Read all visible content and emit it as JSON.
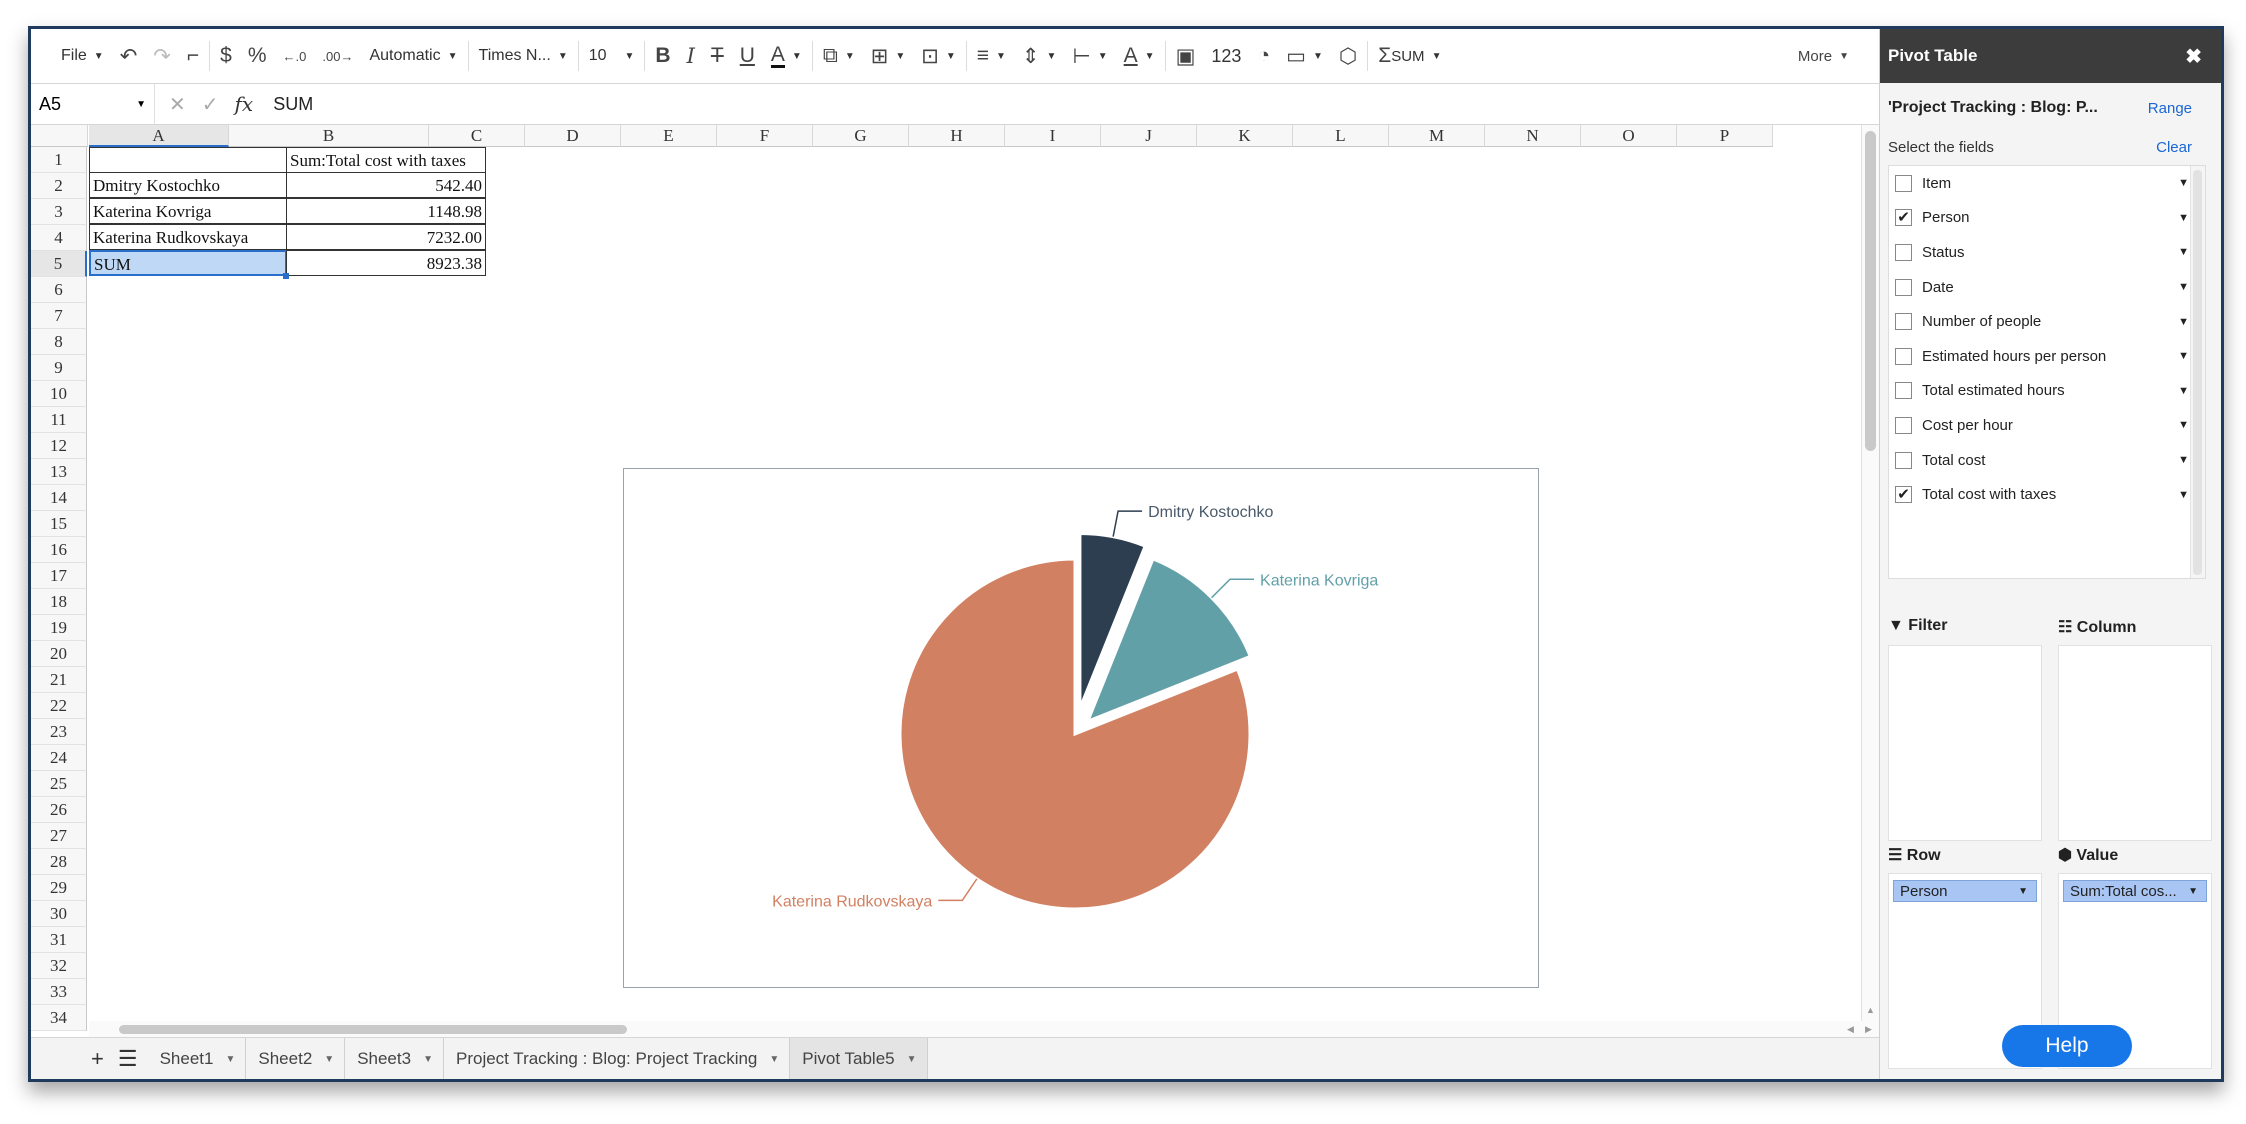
{
  "toolbar": {
    "file": "File",
    "number_format": "Automatic",
    "font_name": "Times N...",
    "font_size": "10",
    "number_label": "123",
    "sum_label": "SUM",
    "more": "More"
  },
  "formula_bar": {
    "cell_ref": "A5",
    "fx": "fx",
    "value": "SUM"
  },
  "columns": [
    "A",
    "B",
    "C",
    "D",
    "E",
    "F",
    "G",
    "H",
    "I",
    "J",
    "K",
    "L",
    "M",
    "N",
    "O",
    "P"
  ],
  "rows": [
    "1",
    "2",
    "3",
    "4",
    "5",
    "6",
    "7",
    "8",
    "9",
    "10",
    "11",
    "12",
    "13",
    "14",
    "15",
    "16",
    "17",
    "18",
    "19",
    "20",
    "21",
    "22",
    "23",
    "24",
    "25",
    "26",
    "27",
    "28",
    "29",
    "30",
    "31",
    "32",
    "33",
    "34"
  ],
  "table": {
    "header": "Sum:Total cost with taxes",
    "rows": [
      {
        "name": "Dmitry Kostochko",
        "value": "542.40"
      },
      {
        "name": "Katerina Kovriga",
        "value": "1148.98"
      },
      {
        "name": "Katerina Rudkovskaya",
        "value": "7232.00"
      },
      {
        "name": "SUM",
        "value": "8923.38"
      }
    ]
  },
  "chart_data": {
    "type": "pie",
    "categories": [
      "Dmitry Kostochko",
      "Katerina Kovriga",
      "Katerina Rudkovskaya"
    ],
    "values": [
      542.4,
      1148.98,
      7232.0
    ],
    "colors": [
      "#2d3e50",
      "#62a0a8",
      "#d28062"
    ]
  },
  "sheets": [
    {
      "label": "Sheet1"
    },
    {
      "label": "Sheet2"
    },
    {
      "label": "Sheet3"
    },
    {
      "label": "Project Tracking : Blog: Project Tracking"
    },
    {
      "label": "Pivot Table5"
    }
  ],
  "pivot": {
    "title": "Pivot Table",
    "source": "'Project Tracking : Blog: P...",
    "range_link": "Range",
    "select_fields": "Select the fields",
    "clear": "Clear",
    "fields": [
      {
        "label": "Item",
        "checked": false
      },
      {
        "label": "Person",
        "checked": true
      },
      {
        "label": "Status",
        "checked": false
      },
      {
        "label": "Date",
        "checked": false
      },
      {
        "label": "Number of people",
        "checked": false
      },
      {
        "label": "Estimated hours per person",
        "checked": false
      },
      {
        "label": "Total estimated hours",
        "checked": false
      },
      {
        "label": "Cost per hour",
        "checked": false
      },
      {
        "label": "Total cost",
        "checked": false
      },
      {
        "label": "Total cost with taxes",
        "checked": true
      }
    ],
    "filter_label": "Filter",
    "column_label": "Column",
    "row_label": "Row",
    "value_label": "Value",
    "row_chip": "Person",
    "value_chip": "Sum:Total cos..."
  },
  "help": "Help",
  "accent": "#1877e8"
}
